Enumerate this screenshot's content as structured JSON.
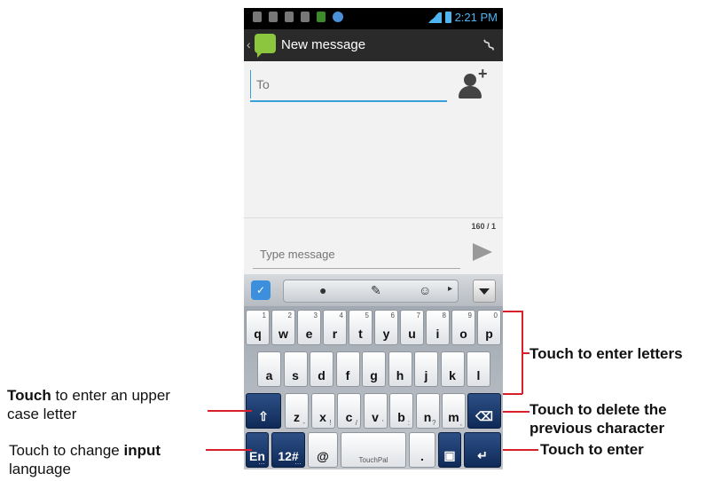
{
  "status_bar": {
    "time": "2:21 PM"
  },
  "action_bar": {
    "title": "New message"
  },
  "recipient": {
    "placeholder": "To"
  },
  "compose": {
    "counter": "160 / 1",
    "placeholder": "Type message"
  },
  "keyboard": {
    "row1": [
      {
        "label": "q",
        "num": "1"
      },
      {
        "label": "w",
        "num": "2"
      },
      {
        "label": "e",
        "num": "3"
      },
      {
        "label": "r",
        "num": "4"
      },
      {
        "label": "t",
        "num": "5"
      },
      {
        "label": "y",
        "num": "6"
      },
      {
        "label": "u",
        "num": "7"
      },
      {
        "label": "i",
        "num": "8"
      },
      {
        "label": "o",
        "num": "9"
      },
      {
        "label": "p",
        "num": "0"
      }
    ],
    "row2": [
      "a",
      "s",
      "d",
      "f",
      "g",
      "h",
      "j",
      "k",
      "l"
    ],
    "row3": [
      {
        "label": "z",
        "sub": "-"
      },
      {
        "label": "x",
        "sub": "!"
      },
      {
        "label": "c",
        "sub": "/"
      },
      {
        "label": "v",
        "sub": "'"
      },
      {
        "label": "b",
        "sub": ":"
      },
      {
        "label": "n",
        "sub": "?"
      },
      {
        "label": "m",
        "sub": ","
      }
    ],
    "lang_key": "En",
    "num_key": "12#",
    "at_key": "@",
    "space_key": "TouchPal",
    "period_key": "."
  },
  "annotations": {
    "letters": "Touch to enter letters",
    "upper_bold": "Touch",
    "upper_rest_line1": " to enter an upper",
    "upper_line2": "case letter",
    "delete_line1": "Touch to delete the",
    "delete_line2": "previous character",
    "lang_plain": "Touch to change ",
    "lang_bold": "input",
    "lang_line2": "language",
    "enter": "Touch to enter"
  },
  "colors": {
    "accent": "#3aa0d9",
    "annotation_line": "#d8202a",
    "dark_key": "#1b3a6e"
  }
}
